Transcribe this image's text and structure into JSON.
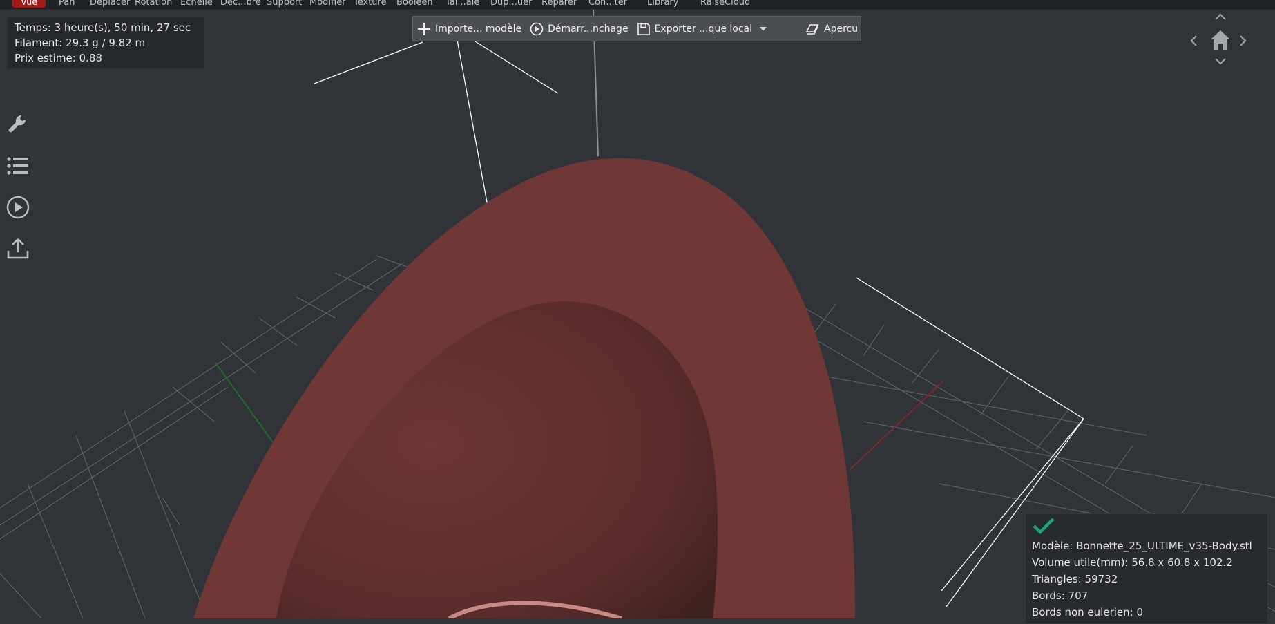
{
  "menu": {
    "items": [
      {
        "label": "Vue",
        "active": true
      },
      {
        "label": "Pan"
      },
      {
        "label": "Deplacer"
      },
      {
        "label": "Rotation"
      },
      {
        "label": "Echelle"
      },
      {
        "label": "Dec...bre"
      },
      {
        "label": "Support"
      },
      {
        "label": "Modifier"
      },
      {
        "label": "Texture"
      },
      {
        "label": "Booleen"
      },
      {
        "label": "Tai...ale"
      },
      {
        "label": "Dup...uer"
      },
      {
        "label": "Reparer"
      },
      {
        "label": "Con...ter"
      },
      {
        "label": "Library"
      },
      {
        "label": "RaiseCloud"
      }
    ]
  },
  "stats": {
    "time": "Temps: 3 heure(s), 50 min, 27 sec",
    "filament": "Filament: 29.3 g / 9.82 m",
    "price": "Prix estime: 0.88"
  },
  "toolbar": {
    "import_label": "Importe... modèle",
    "start_label": "Démarr...nchage",
    "export_label": "Exporter ...que local",
    "preview_label": "Apercu"
  },
  "side_tools": [
    {
      "icon": "wrench-icon"
    },
    {
      "icon": "list-icon"
    },
    {
      "icon": "play-icon"
    },
    {
      "icon": "upload-icon"
    }
  ],
  "model_info": {
    "status_icon": "checkmark-icon",
    "model": "Modèle: Bonnette_25_ULTIME_v35-Body.stl",
    "volume": "Volume utile(mm): 56.8 x 60.8 x 102.2",
    "triangles": "Triangles: 59732",
    "edges": "Bords: 707",
    "non_eulerian": "Bords non eulerien: 0"
  },
  "colors": {
    "background": "#303439",
    "model": "#6f3735",
    "accent_active": "#a31a1a",
    "status_ok": "#1fa37a",
    "axis_x": "#7a2a2a",
    "axis_y": "#1e6a2a"
  }
}
